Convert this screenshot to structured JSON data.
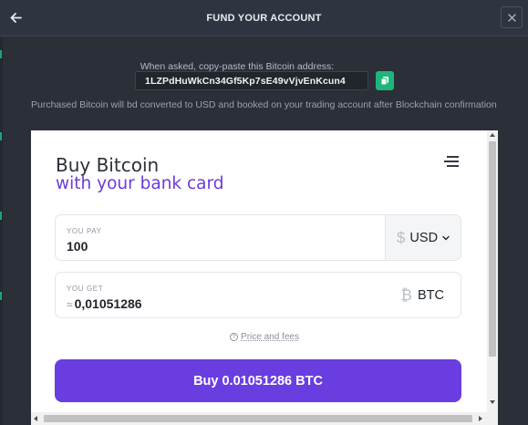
{
  "header": {
    "title": "FUND YOUR ACCOUNT",
    "back_icon": "arrow-left-icon",
    "close_icon": "close-icon"
  },
  "address": {
    "label": "When asked, copy-paste this Bitcoin address:",
    "value": "1LZPdHuWkCn34Gf5Kp7sE49vVjvEnKcun4",
    "copy_icon": "copy-icon"
  },
  "info_text": "Purchased Bitcoin will bd converted to USD and booked on your trading account after Blockchain confirmation",
  "widget": {
    "title": "Buy Bitcoin",
    "subtitle": "with your bank card",
    "menu_icon": "menu-icon",
    "pay": {
      "label": "YOU PAY",
      "value": "100",
      "currency": "USD",
      "currency_symbol": "$"
    },
    "get": {
      "label": "YOU GET",
      "approx": "≈",
      "value": "0,01051286",
      "currency": "BTC",
      "currency_symbol": "₿"
    },
    "price_fees": "Price and fees",
    "buy_button": "Buy 0.01051286 BTC"
  },
  "colors": {
    "background": "#2a2f38",
    "accent": "#6a3de0",
    "copy_button": "#1fb57a"
  }
}
